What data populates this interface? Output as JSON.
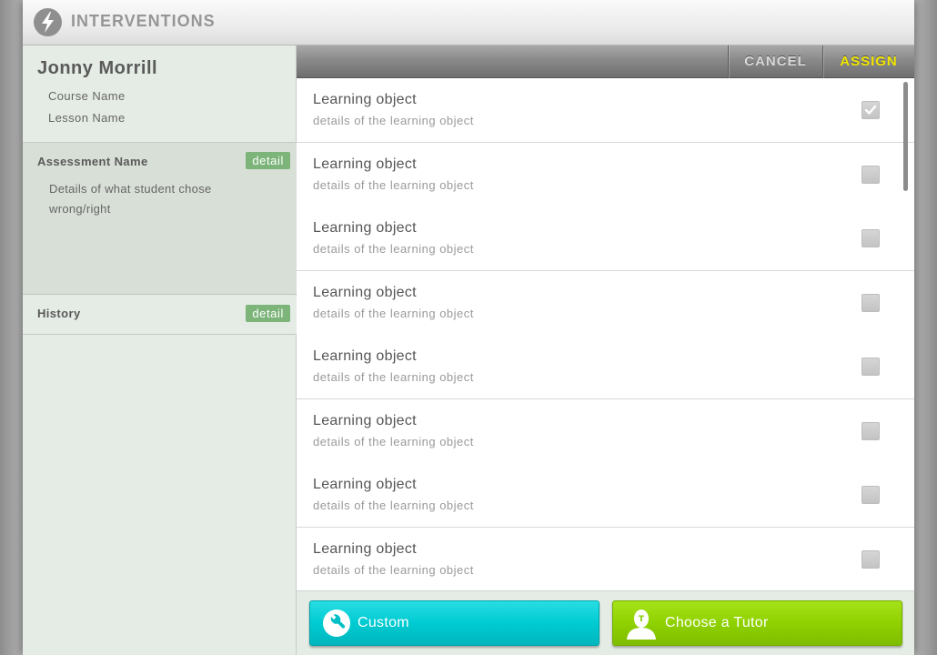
{
  "app": {
    "title": "INTERVENTIONS",
    "icon": "lightning-icon"
  },
  "student": {
    "name": "Jonny Morrill",
    "course": "Course Name",
    "lesson": "Lesson Name"
  },
  "assessment": {
    "title": "Assessment Name",
    "detail_label": "detail",
    "body": "Details of what student chose wrong/right"
  },
  "history": {
    "title": "History",
    "detail_label": "detail"
  },
  "actions": {
    "cancel_label": "CANCEL",
    "assign_label": "ASSIGN"
  },
  "items": [
    {
      "title": "Learning object",
      "detail": "details of the learning object",
      "checked": true
    },
    {
      "title": "Learning object",
      "detail": "details of the learning object",
      "checked": false
    },
    {
      "title": "Learning object",
      "detail": "details of the learning object",
      "checked": false
    },
    {
      "title": "Learning object",
      "detail": "details of the learning object",
      "checked": false
    },
    {
      "title": "Learning object",
      "detail": "details of the learning object",
      "checked": false
    },
    {
      "title": "Learning object",
      "detail": "details of the learning object",
      "checked": false
    },
    {
      "title": "Learning object",
      "detail": "details of the learning object",
      "checked": false
    },
    {
      "title": "Learning object",
      "detail": "details of the learning object",
      "checked": false
    }
  ],
  "footer": {
    "custom_label": "Custom",
    "custom_icon": "wrench-icon",
    "tutor_label": "Choose a Tutor",
    "tutor_icon": "tutor-person-icon"
  },
  "colors": {
    "assign": "#f2e600",
    "custom_button": "#00cbd2",
    "tutor_button": "#8fd100",
    "detail_badge": "#7cb479"
  }
}
